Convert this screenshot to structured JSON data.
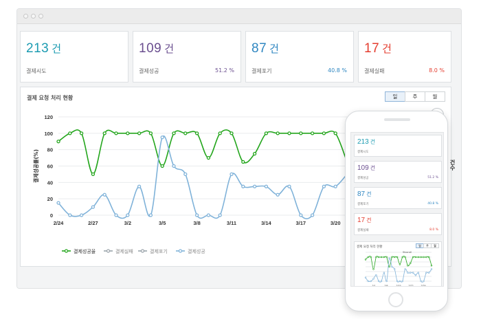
{
  "colors": {
    "green": "#22a51b",
    "blue": "#7fb2d9",
    "teal": "#1b9bb1",
    "purple": "#6a4e8f",
    "sky": "#2e86c1",
    "red": "#e43d2f"
  },
  "cards": [
    {
      "value": "213",
      "unit": "건",
      "label": "결제시도",
      "pct": "",
      "color": "#1b9bb1"
    },
    {
      "value": "109",
      "unit": "건",
      "label": "결제성공",
      "pct": "51.2 %",
      "color": "#6a4e8f"
    },
    {
      "value": "87",
      "unit": "건",
      "label": "결제포기",
      "pct": "40.8 %",
      "color": "#2e86c1"
    },
    {
      "value": "17",
      "unit": "건",
      "label": "결제실패",
      "pct": "8.0 %",
      "color": "#e43d2f"
    }
  ],
  "panel": {
    "title": "결제 요청 처리 현황",
    "tabs": [
      "일",
      "주",
      "월"
    ],
    "active_tab": "일",
    "download_icon": "download-icon"
  },
  "side_label": "건수",
  "phone": {
    "cards": [
      {
        "value": "213",
        "unit": "건",
        "label": "결제시도",
        "pct": "",
        "color": "#1b9bb1"
      },
      {
        "value": "109",
        "unit": "건",
        "label": "결제성공",
        "pct": "51.2 %",
        "color": "#6a4e8f"
      },
      {
        "value": "87",
        "unit": "건",
        "label": "결제포기",
        "pct": "40.8 %",
        "color": "#2e86c1"
      },
      {
        "value": "17",
        "unit": "건",
        "label": "결제실패",
        "pct": "8.0 %",
        "color": "#e43d2f"
      }
    ],
    "panel_title": "결제 요청 처리 현황",
    "tabs": [
      "일",
      "주",
      "월"
    ],
    "show_all": "Show all",
    "x_ticks": [
      "3/1",
      "3/8",
      "3/15",
      "3/22",
      "3/29"
    ]
  },
  "chart_data": {
    "type": "line",
    "ylabel": "결제성공률(%)",
    "ylim": [
      0,
      120
    ],
    "yticks": [
      0,
      20,
      40,
      60,
      80,
      100,
      120
    ],
    "x_tick_labels": [
      "2/24",
      "2/27",
      "3/2",
      "3/5",
      "3/8",
      "3/11",
      "3/14",
      "3/17",
      "3/20"
    ],
    "categories": [
      "2/24",
      "2/25",
      "2/26",
      "2/27",
      "2/28",
      "3/1",
      "3/2",
      "3/3",
      "3/4",
      "3/5",
      "3/6",
      "3/7",
      "3/8",
      "3/9",
      "3/10",
      "3/11",
      "3/12",
      "3/13",
      "3/14",
      "3/15",
      "3/16",
      "3/17",
      "3/18",
      "3/19",
      "3/20",
      "3/21"
    ],
    "legend": [
      "결제성공율",
      "결제실패",
      "결제포기",
      "결제성공"
    ],
    "series": [
      {
        "name": "결제성공율",
        "color": "#22a51b",
        "values": [
          90,
          100,
          100,
          50,
          100,
          100,
          100,
          100,
          100,
          60,
          100,
          100,
          100,
          70,
          100,
          100,
          65,
          75,
          100,
          100,
          100,
          100,
          100,
          100,
          100,
          65
        ]
      },
      {
        "name": "결제성공",
        "color": "#7fb2d9",
        "values": [
          15,
          0,
          0,
          10,
          25,
          0,
          0,
          35,
          0,
          95,
          60,
          50,
          0,
          0,
          0,
          50,
          35,
          35,
          35,
          25,
          35,
          0,
          0,
          35,
          35,
          50
        ]
      }
    ]
  }
}
